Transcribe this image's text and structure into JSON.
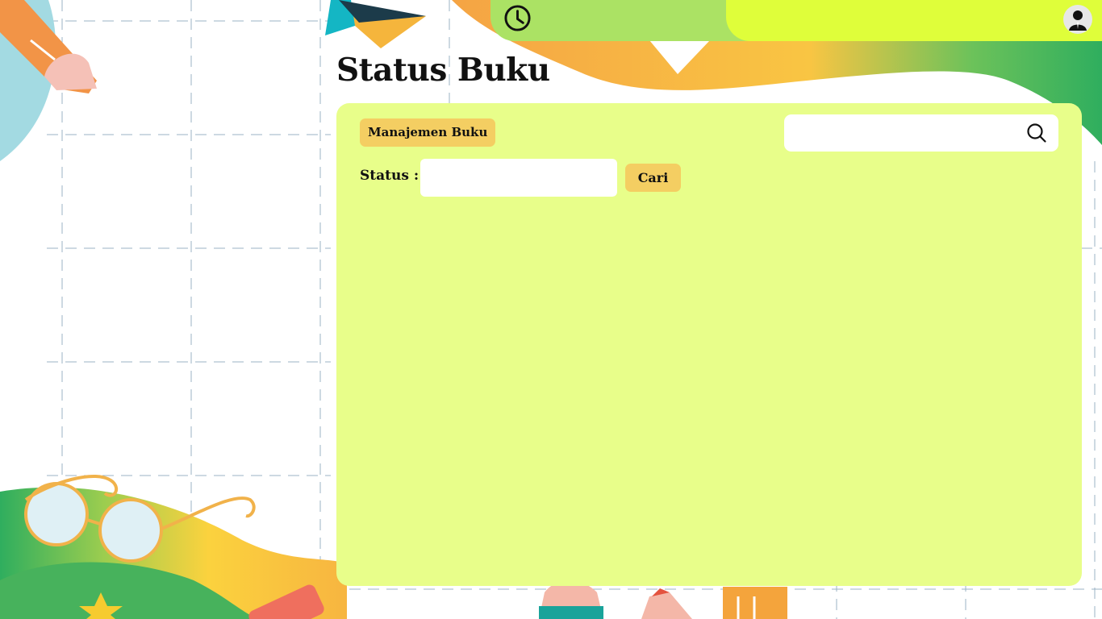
{
  "page": {
    "title": "Status Buku"
  },
  "header": {
    "clock_icon": "clock-icon",
    "avatar_icon": "user-avatar-icon"
  },
  "toolbar": {
    "manage_label": "Manajemen Buku"
  },
  "search": {
    "value": "",
    "placeholder": "",
    "icon": "search-icon"
  },
  "filter": {
    "status_label": "Status :",
    "status_value": "",
    "search_button": "Cari"
  },
  "colors": {
    "panel": "#e8fe8a",
    "chip": "#f4ce62",
    "topbar_left": "#abe264",
    "topbar_right": "#dffe3a"
  }
}
